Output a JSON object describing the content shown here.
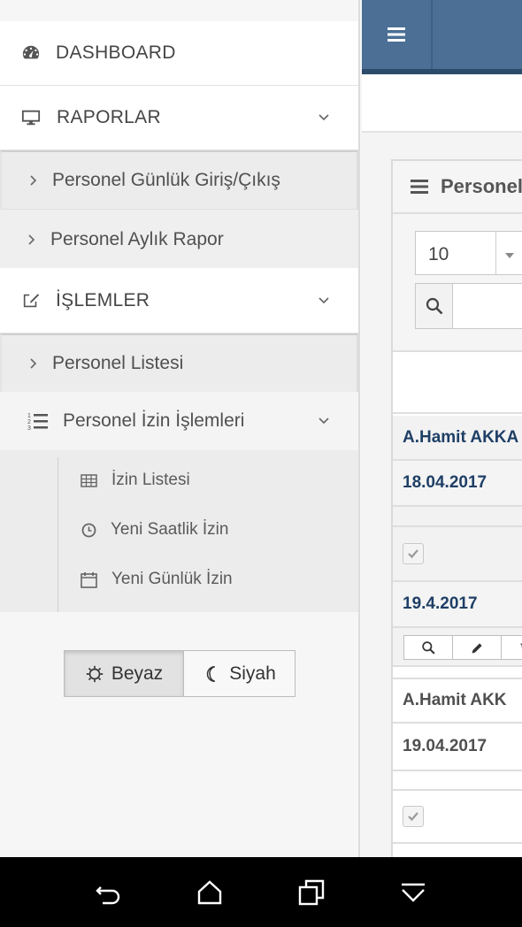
{
  "sidebar": {
    "dashboard": {
      "label": "DASHBOARD",
      "icon": "dashboard-icon"
    },
    "raporlar": {
      "label": "RAPORLAR",
      "icon": "desktop-icon",
      "items": [
        {
          "label": "Personel Günlük Giriş/Çıkış"
        },
        {
          "label": "Personel Aylık Rapor"
        }
      ]
    },
    "islemler": {
      "label": "İŞLEMLER",
      "icon": "edit-icon",
      "items": [
        {
          "label": "Personel Listesi"
        }
      ],
      "izin": {
        "label": "Personel İzin İşlemleri",
        "icon": "numbered-list-icon",
        "items": [
          {
            "label": "İzin Listesi",
            "icon": "table-icon"
          },
          {
            "label": "Yeni Saatlik İzin",
            "icon": "clock-icon"
          },
          {
            "label": "Yeni Günlük İzin",
            "icon": "calendar-icon"
          }
        ]
      }
    },
    "theme": {
      "light_label": "Beyaz",
      "dark_label": "Siyah",
      "selected": "Beyaz"
    }
  },
  "main": {
    "panel_title": "Personel",
    "page_size": "10",
    "search_value": "",
    "records": [
      {
        "name": "A.Hamit AKKA",
        "date": "18.04.2017",
        "date2": "19.4.2017"
      },
      {
        "name": "A.Hamit AKK",
        "date": "19.04.2017"
      }
    ]
  },
  "colors": {
    "topbar": "#4b6f95",
    "topbar_border": "#2c4a6a",
    "link_blue": "#1f3f66",
    "sidebar_bg": "#f6f6f6"
  }
}
